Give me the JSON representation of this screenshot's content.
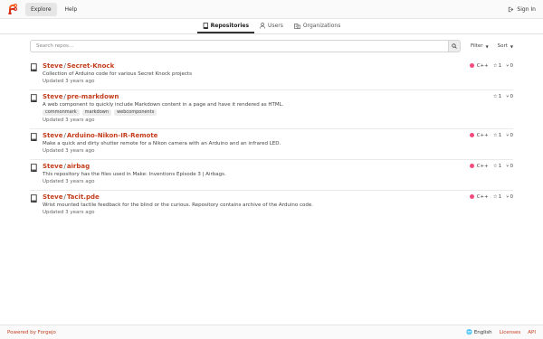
{
  "nav": {
    "explore_label": "Explore",
    "help_label": "Help",
    "signin_label": "Sign In"
  },
  "tabs": [
    {
      "label": "Repositories",
      "icon": "repo-icon"
    },
    {
      "label": "Users",
      "icon": "person-icon"
    },
    {
      "label": "Organizations",
      "icon": "organization-icon"
    }
  ],
  "search": {
    "placeholder": "Search repos...",
    "filter_label": "Filter",
    "sort_label": "Sort"
  },
  "repos": [
    {
      "owner": "Steve",
      "name": "Secret-Knock",
      "description": "Collection of Arduino code for various Secret Knock projects",
      "updated": "Updated 3 years ago",
      "language": "C++",
      "language_color": "#f34b7d",
      "stars": "1",
      "forks": "0",
      "topics": []
    },
    {
      "owner": "Steve",
      "name": "pre-markdown",
      "description": "A web component to quickly include Markdown content in a page and have it rendered as HTML.",
      "updated": "Updated 3 years ago",
      "language": "",
      "language_color": "",
      "stars": "1",
      "forks": "0",
      "topics": [
        "commonmark",
        "markdown",
        "webcomponents"
      ]
    },
    {
      "owner": "Steve",
      "name": "Arduino-Nikon-IR-Remote",
      "description": "Make a quick and dirty shutter remote for a Nikon camera with an Arduino and an infrared LED.",
      "updated": "Updated 3 years ago",
      "language": "C++",
      "language_color": "#f34b7d",
      "stars": "1",
      "forks": "0",
      "topics": []
    },
    {
      "owner": "Steve",
      "name": "airbag",
      "description": "This repository has the files used in Make: Inventions Episode 3 | Airbags.",
      "updated": "Updated 3 years ago",
      "language": "C++",
      "language_color": "#f34b7d",
      "stars": "1",
      "forks": "0",
      "topics": []
    },
    {
      "owner": "Steve",
      "name": "Tacit.pde",
      "description": "Wrist mounted tactile feedback for the blind or the curious. Repository contains archive of the Arduino code.",
      "updated": "Updated 3 years ago",
      "language": "C++",
      "language_color": "#f34b7d",
      "stars": "1",
      "forks": "0",
      "topics": []
    }
  ],
  "footer": {
    "powered_by": "Powered by Forgejo",
    "language": "English",
    "licenses": "Licenses",
    "api": "API"
  }
}
